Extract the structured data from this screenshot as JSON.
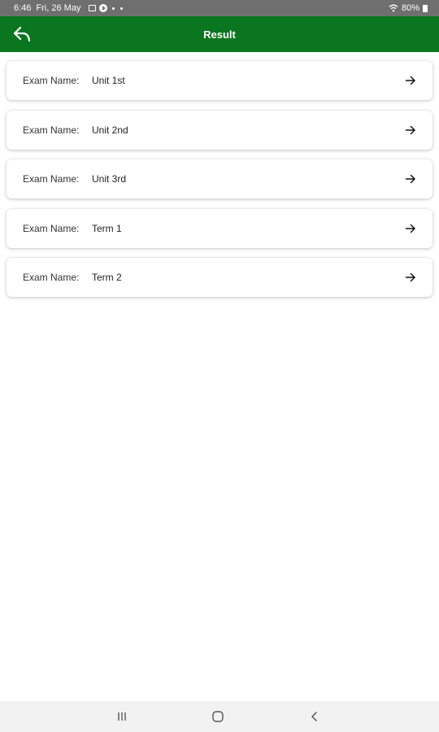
{
  "status_bar": {
    "time": "6:46",
    "date": "Fri, 26 May",
    "battery": "80%"
  },
  "app_bar": {
    "title": "Result",
    "back_icon": "reply-arrow-icon",
    "color": "#0a761f"
  },
  "exams": [
    {
      "label": "Exam Name:",
      "name": "Unit 1st"
    },
    {
      "label": "Exam Name:",
      "name": "Unit 2nd"
    },
    {
      "label": "Exam Name:",
      "name": "Unit 3rd"
    },
    {
      "label": "Exam Name:",
      "name": "Term 1"
    },
    {
      "label": "Exam Name:",
      "name": "Term 2"
    }
  ],
  "nav_bar": {
    "recents_icon": "recent-apps-icon",
    "home_icon": "home-icon",
    "back_icon": "back-icon"
  }
}
